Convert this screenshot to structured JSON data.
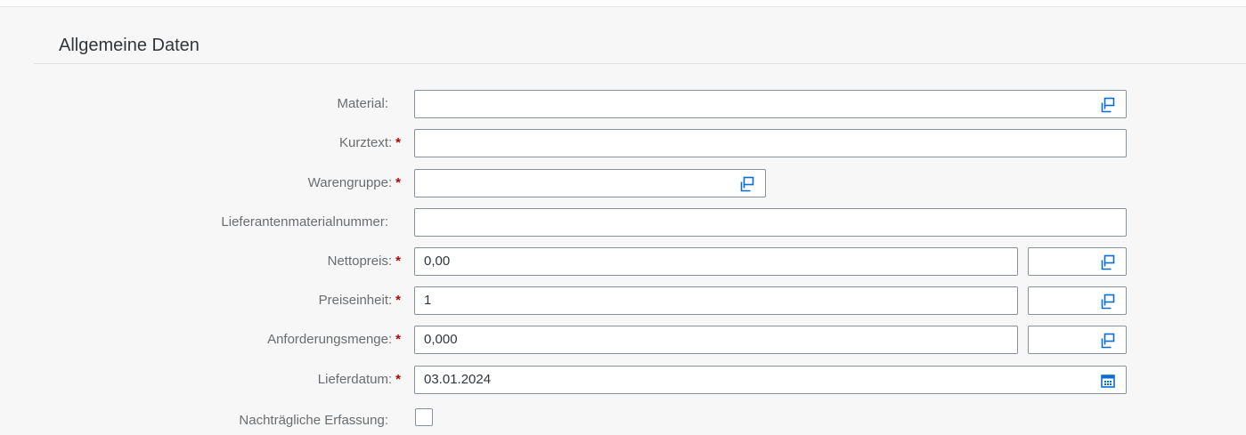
{
  "section": {
    "title": "Allgemeine Daten"
  },
  "required_marker": "*",
  "fields": {
    "material": {
      "label": "Material:",
      "value": ""
    },
    "kurztext": {
      "label": "Kurztext:",
      "value": ""
    },
    "warengruppe": {
      "label": "Warengruppe:",
      "value": ""
    },
    "lieferantenmaterialnummer": {
      "label": "Lieferantenmaterialnummer:",
      "value": ""
    },
    "nettopreis": {
      "label": "Nettopreis:",
      "value": "0,00",
      "unit": ""
    },
    "preiseinheit": {
      "label": "Preiseinheit:",
      "value": "1",
      "unit": ""
    },
    "anforderungsmenge": {
      "label": "Anforderungsmenge:",
      "value": "0,000",
      "unit": ""
    },
    "lieferdatum": {
      "label": "Lieferdatum:",
      "value": "03.01.2024"
    },
    "nachtraegliche_erfassung": {
      "label": "Nachträgliche Erfassung:",
      "checked": false
    }
  },
  "icons": {
    "value_help": "value-help-icon",
    "calendar": "calendar-icon"
  },
  "colors": {
    "required": "#bb0000",
    "accent": "#0a6ed1",
    "border": "#89919a",
    "label": "#6a6d70"
  }
}
